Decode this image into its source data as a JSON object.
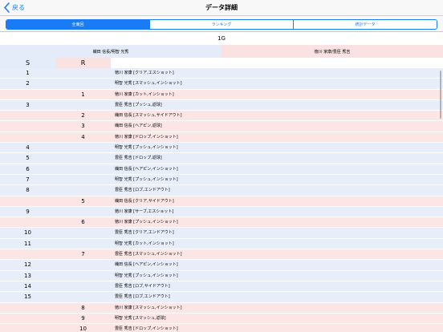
{
  "nav": {
    "back_label": "戻る",
    "title": "データ詳細"
  },
  "segments": [
    {
      "label": "全東回",
      "active": true
    },
    {
      "label": "ランキング",
      "active": false
    },
    {
      "label": "統計データ",
      "active": false
    }
  ],
  "game_label": "1G",
  "teams": {
    "left": "織田 信長/明智 光秀",
    "right": "徳川 家康/豊臣 秀吉"
  },
  "columns": {
    "s": "S",
    "r": "R"
  },
  "rows": [
    {
      "side": "blue",
      "s": "1",
      "r": "",
      "detail": "徳川 家康 [クリア,エスショット]"
    },
    {
      "side": "blue",
      "s": "2",
      "r": "",
      "detail": "明智 光秀 [スマッシュ,インショット]"
    },
    {
      "side": "pink",
      "s": "",
      "r": "1",
      "detail": "徳川 家康 [カット,インショット]"
    },
    {
      "side": "blue",
      "s": "3",
      "r": "",
      "detail": "豊臣 秀吉 [プッシュ,返球]"
    },
    {
      "side": "pink",
      "s": "",
      "r": "2",
      "detail": "織田 信長 [スマッシュ,サイドアウト]"
    },
    {
      "side": "pink",
      "s": "",
      "r": "3",
      "detail": "織田 信長 [ヘアピン,返球]"
    },
    {
      "side": "pink",
      "s": "",
      "r": "4",
      "detail": "徳川 家康 [ドロップ,インショット]"
    },
    {
      "side": "blue",
      "s": "4",
      "r": "",
      "detail": "明智 光秀 [プッシュ,インショット]"
    },
    {
      "side": "blue",
      "s": "5",
      "r": "",
      "detail": "豊臣 秀吉 [ドロップ,返球]"
    },
    {
      "side": "blue",
      "s": "6",
      "r": "",
      "detail": "織田 信長 [ヘアピン,インショット]"
    },
    {
      "side": "blue",
      "s": "7",
      "r": "",
      "detail": "明智 光秀 [プッシュ,インショット]"
    },
    {
      "side": "blue",
      "s": "8",
      "r": "",
      "detail": "豊臣 秀吉 [ロブ,エンドアウト]"
    },
    {
      "side": "pink",
      "s": "",
      "r": "5",
      "detail": "織田 信長 [クリア,サイドアウト]"
    },
    {
      "side": "blue",
      "s": "9",
      "r": "",
      "detail": "徳川 家康 [サーブ,エスショット]"
    },
    {
      "side": "pink",
      "s": "",
      "r": "6",
      "detail": "徳川 家康 [プッシュ,インショット]"
    },
    {
      "side": "blue",
      "s": "10",
      "r": "",
      "detail": "豊臣 秀吉 [クリア,エンドアウト]"
    },
    {
      "side": "blue",
      "s": "11",
      "r": "",
      "detail": "明智 光秀 [カット,インショット]"
    },
    {
      "side": "pink",
      "s": "",
      "r": "7",
      "detail": "豊臣 秀吉 [スマッシュ,インショット]"
    },
    {
      "side": "blue",
      "s": "12",
      "r": "",
      "detail": "織田 信長 [ヘアピン,インショット]"
    },
    {
      "side": "blue",
      "s": "13",
      "r": "",
      "detail": "明智 光秀 [プッシュ,インショット]"
    },
    {
      "side": "blue",
      "s": "14",
      "r": "",
      "detail": "豊臣 秀吉 [ロブ,サイドアウト]"
    },
    {
      "side": "blue",
      "s": "15",
      "r": "",
      "detail": "豊臣 秀吉 [ロブ,エンドアウト]"
    },
    {
      "side": "pink",
      "s": "",
      "r": "8",
      "detail": "徳川 家康 [スマッシュ,インショット]"
    },
    {
      "side": "pink",
      "s": "",
      "r": "9",
      "detail": "明智 光秀 [スマッシュ,返球]"
    },
    {
      "side": "pink",
      "s": "",
      "r": "10",
      "detail": "豊臣 秀吉 [ドロップ,インショット]"
    }
  ],
  "colors": {
    "accent": "#1a7cf5",
    "serve_row": "#e7eefa",
    "receive_row": "#fce5e5"
  }
}
